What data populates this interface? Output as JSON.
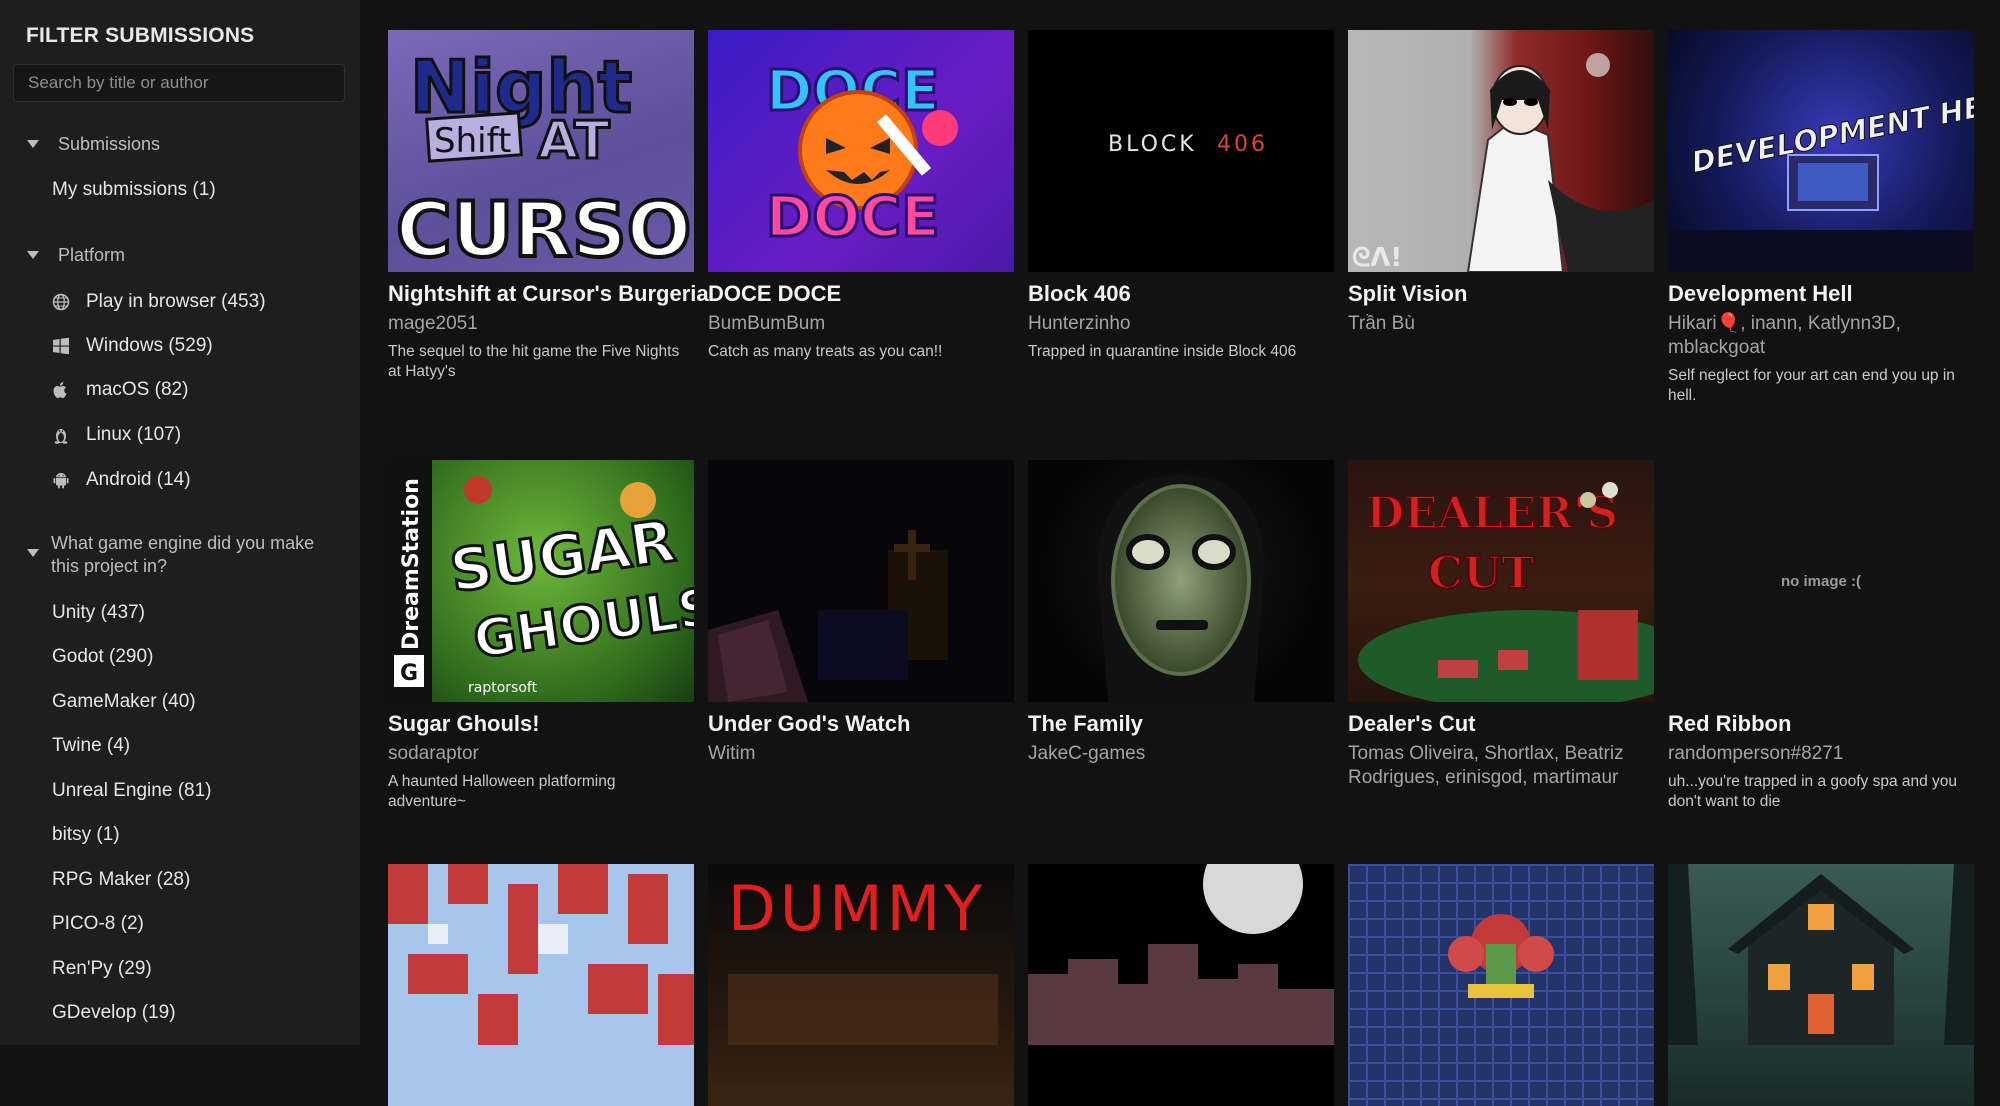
{
  "sidebar": {
    "title": "FILTER SUBMISSIONS",
    "search_placeholder": "Search by title or author",
    "sections": {
      "submissions": {
        "label": "Submissions",
        "items": [
          {
            "label": "My submissions (1)"
          }
        ]
      },
      "platform": {
        "label": "Platform",
        "items": [
          {
            "label": "Play in browser (453)",
            "icon": "globe-icon"
          },
          {
            "label": "Windows (529)",
            "icon": "windows-icon"
          },
          {
            "label": "macOS (82)",
            "icon": "apple-icon"
          },
          {
            "label": "Linux (107)",
            "icon": "linux-icon"
          },
          {
            "label": "Android (14)",
            "icon": "android-icon"
          }
        ]
      },
      "engine": {
        "label": "What game engine did you make this project in?",
        "items": [
          {
            "label": "Unity (437)"
          },
          {
            "label": "Godot (290)"
          },
          {
            "label": "GameMaker (40)"
          },
          {
            "label": "Twine (4)"
          },
          {
            "label": "Unreal Engine (81)"
          },
          {
            "label": "bitsy (1)"
          },
          {
            "label": "RPG Maker (28)"
          },
          {
            "label": "PICO-8 (2)"
          },
          {
            "label": "Ren'Py (29)"
          },
          {
            "label": "GDevelop (19)"
          }
        ]
      }
    }
  },
  "cards": [
    {
      "title": "Nightshift at Cursor's Burgeria",
      "author": "mage2051",
      "desc": "The sequel to the hit game the Five Nights at Hatyy's",
      "thumb_text": [
        "Night",
        "Shift",
        "AT",
        "CURSOR"
      ]
    },
    {
      "title": "DOCE DOCE",
      "author": "BumBumBum",
      "desc": "Catch as many treats as you can!!",
      "thumb_text": [
        "DOCE",
        "DOCE"
      ]
    },
    {
      "title": "Block 406",
      "author": "Hunterzinho",
      "desc": "Trapped in quarantine inside Block 406",
      "thumb_text": [
        "BLOCK",
        "406"
      ]
    },
    {
      "title": "Split Vision",
      "author": "Trần Bù",
      "desc": ""
    },
    {
      "title": "Development Hell",
      "author": "Hikari🎈, inann, Katlynn3D, mblackgoat",
      "desc": "Self neglect for your art can end you up in hell.",
      "thumb_text": [
        "DEVELOPMENT HELL"
      ]
    },
    {
      "title": "Sugar Ghouls!",
      "author": "sodaraptor",
      "desc": "A haunted Halloween platforming adventure~",
      "thumb_text": [
        "SUGAR",
        "GHOULS!",
        "DreamStation",
        "raptorsoft",
        "G"
      ]
    },
    {
      "title": "Under God's Watch",
      "author": "Witim",
      "desc": ""
    },
    {
      "title": "The Family",
      "author": "JakeC-games",
      "desc": ""
    },
    {
      "title": "Dealer's Cut",
      "author": "Tomas Oliveira, Shortlax, Beatriz Rodrigues, erinisgod, martimaur",
      "desc": "",
      "thumb_text": [
        "DEALER'S",
        "CUT"
      ]
    },
    {
      "title": "Red Ribbon",
      "author": "randomperson#8271",
      "desc": "uh...you're trapped in a goofy spa and you don't want to die",
      "thumb_text": [
        "no image :("
      ]
    },
    {
      "title": "",
      "author": "",
      "desc": ""
    },
    {
      "title": "",
      "author": "",
      "desc": "",
      "thumb_text": [
        "DUMMY"
      ]
    },
    {
      "title": "",
      "author": "",
      "desc": ""
    },
    {
      "title": "",
      "author": "",
      "desc": ""
    },
    {
      "title": "",
      "author": "",
      "desc": ""
    }
  ]
}
